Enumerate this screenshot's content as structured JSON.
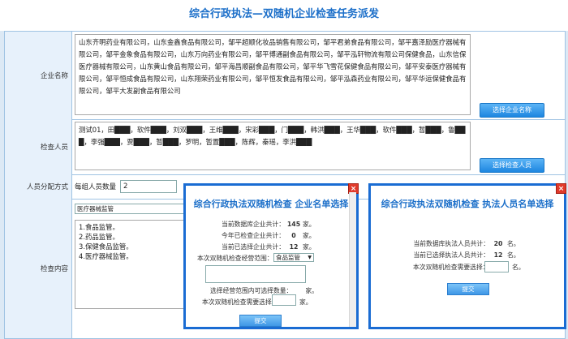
{
  "title": "综合行政执法—双随机企业检查任务派发",
  "form": {
    "company_label": "企业名称",
    "company_text": "山东齐明药业有限公司，山东金鑫食品有限公司，邹平超顺化妆品销售有限公司，邹平君弟食品有限公司，邹平嘉泽励医疗器械有限公司，邹平金象食品有限公司，山东万向药业有限公司，邹平博通副食品有限公司，邹平泓轩物流有限公司保健食品，山东信保医疗器械有限公司，山东黄山食品有限公司，邹平海昌顺副食品有限公司，邹平华飞雪花保健食品有限公司，邹平安泰医疗器械有限公司，邹平恒成食品有限公司，山东翔荣药业有限公司，邹平恒发食品有限公司，邹平泓森药业有限公司，邹平华运保健食品有限公司，邹平大发副食品有限公司",
    "select_company_btn": "选择企业名称",
    "inspector_label": "检查人员",
    "inspector_text": "测试01，田███，软件███，刘双███，王维███，宋彩███，门███，韩洪███，王华███，软件███，暂███，鲁███，李强███，贾███，暂███，罗明，暂置███，陈辉，秦瑶，李洪███",
    "select_inspector_btn": "选择检查人员",
    "allocation_label": "人员分配方式",
    "per_group_label": "每组人员数量",
    "per_group_value": "2",
    "category_value": "医疗器械监管",
    "content_label": "检查内容",
    "content_lines": [
      "1.食品监管。",
      "2.药品监管。",
      "3.保健食品监管。",
      "4.医疗器械监管。"
    ]
  },
  "modal_company": {
    "title": "综合行政执法双随机检查  企业名单选择",
    "close": "×",
    "rows": [
      {
        "k": "当前数据库企业共计：",
        "v": "145",
        "u": "家。"
      },
      {
        "k": "今年已检查企业共计：",
        "v": "0",
        "u": "家。"
      },
      {
        "k": "当前已选择企业共计：",
        "v": "12",
        "u": "家。"
      }
    ],
    "scope_label": "本次双随机检查经营范围：",
    "scope_value": "食品监管",
    "selectable_label": "选择经营范围内可选择数量：",
    "selectable_unit": "家。",
    "need_label": "本次双随机检查需要选择：",
    "need_unit": "家。",
    "submit": "提交"
  },
  "modal_inspector": {
    "title": "综合行政执法双随机检查  执法人员名单选择",
    "close": "×",
    "rows": [
      {
        "k": "当前数据库执法人员共计：",
        "v": "20",
        "u": "名。"
      },
      {
        "k": "当前已选择执法人员共计：",
        "v": "12",
        "u": "名。"
      }
    ],
    "need_label": "本次双随机检查需要选择：",
    "need_unit": "名。",
    "submit": "提交"
  },
  "colors": {
    "accent": "#1c6fc9",
    "modal_border": "#1a6cd3",
    "close_red": "#e03a2b"
  }
}
